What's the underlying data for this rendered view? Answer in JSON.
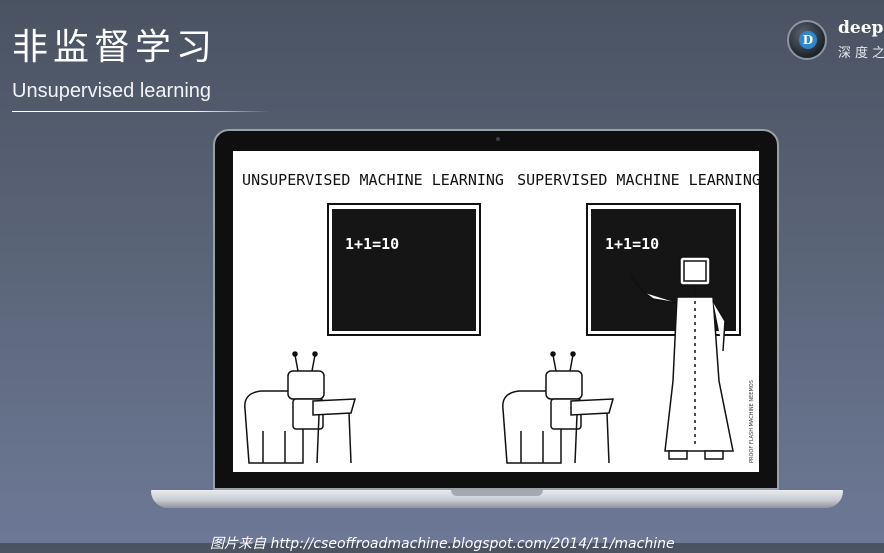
{
  "slide": {
    "title": "非监督学习",
    "subtitle": "Unsupervised learning",
    "caption": "图片来自 http://cseoffroadmachine.blogspot.com/2014/11/machine"
  },
  "logo": {
    "name": "deep",
    "chinese": "深度之",
    "letter": "D"
  },
  "cartoon": {
    "left_heading": "UNSUPERVISED MACHINE LEARNING",
    "right_heading": "SUPERVISED MACHINE LEARNING",
    "left_board_text": "1+1=10",
    "right_board_text": "1+1=10",
    "credit": "PROOF FLASH MACHINE NEEMOS"
  },
  "colors": {
    "background_top": "#4a5362",
    "background_bottom": "#6d7896",
    "board": "#151515",
    "accent_blue": "#2f86c9"
  }
}
